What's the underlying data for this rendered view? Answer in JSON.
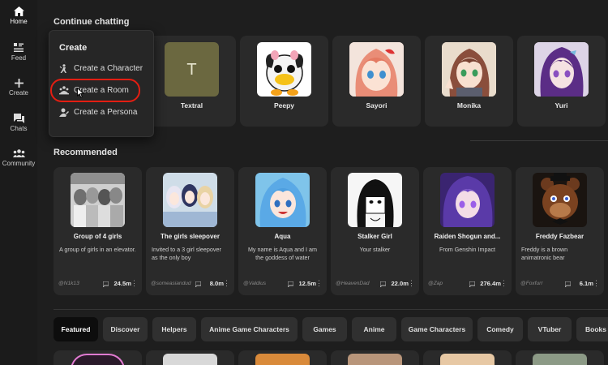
{
  "nav": {
    "home": "Home",
    "feed": "Feed",
    "create": "Create",
    "chats": "Chats",
    "community": "Community"
  },
  "sections": {
    "continue": "Continue chatting",
    "recommended": "Recommended"
  },
  "continue_chats": [
    {
      "name": "Textral",
      "initial": "T"
    },
    {
      "name": "Peepy"
    },
    {
      "name": "Sayori"
    },
    {
      "name": "Monika"
    },
    {
      "name": "Yuri"
    }
  ],
  "recommended": [
    {
      "name": "Group of 4 girls",
      "desc": "A group of girls in an elevator.",
      "creator": "@N1k13",
      "count": "24.5m"
    },
    {
      "name": "The girls sleepover",
      "desc": "Invited to a 3 girl sleepover as the only boy",
      "creator": "@someasiandud",
      "count": "8.0m"
    },
    {
      "name": "Aqua",
      "desc": "My name is Aqua and I am the goddess of water",
      "creator": "@Valdius",
      "count": "12.5m"
    },
    {
      "name": "Stalker Girl",
      "desc": "Your stalker",
      "creator": "@HeavenDad",
      "count": "22.0m"
    },
    {
      "name": "Raiden Shogun and...",
      "desc": "From Genshin Impact",
      "creator": "@Zap",
      "count": "276.4m"
    },
    {
      "name": "Freddy Fazbear",
      "desc": "Freddy is a brown animatronic bear",
      "creator": "@Foxfurr",
      "count": "6.1m"
    }
  ],
  "tabs": [
    "Featured",
    "Discover",
    "Helpers",
    "Anime Game Characters",
    "Games",
    "Anime",
    "Game Characters",
    "Comedy",
    "VTuber",
    "Books"
  ],
  "popup": {
    "title": "Create",
    "items": [
      "Create a Character",
      "Create a Room",
      "Create a Persona"
    ]
  },
  "colors": {
    "background": "#1e1e1e",
    "card": "#2a2a2a",
    "highlight": "#e31e12"
  }
}
